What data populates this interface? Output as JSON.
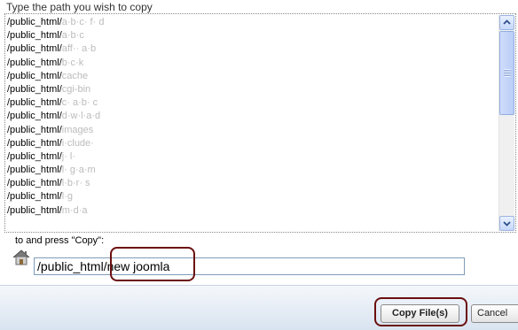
{
  "dialog": {
    "prompt_label": "Type the path you wish to copy",
    "instruction_label": "to and press \"Copy\":",
    "destination_path": "/public_html/new joomla",
    "copy_button_label": "Copy File(s)",
    "cancel_button_label": "Cancel"
  },
  "directory_list": [
    {
      "prefix": "/public_html/",
      "rest": "a·b·c· f· d"
    },
    {
      "prefix": "/public_html/",
      "rest": "a·b·c"
    },
    {
      "prefix": "/public_html/",
      "rest": "aff·· a·b"
    },
    {
      "prefix": "/public_html/",
      "rest": "b·c·k"
    },
    {
      "prefix": "/public_html/",
      "rest": "cache"
    },
    {
      "prefix": "/public_html/",
      "rest": "cgi-bin"
    },
    {
      "prefix": "/public_html/",
      "rest": "c· a·b· c"
    },
    {
      "prefix": "/public_html/",
      "rest": "d·w·l·a·d"
    },
    {
      "prefix": "/public_html/",
      "rest": "images"
    },
    {
      "prefix": "/public_html/",
      "rest": "i·clude·"
    },
    {
      "prefix": "/public_html/",
      "rest": "j· l·"
    },
    {
      "prefix": "/public_html/",
      "rest": "l· g·a·m"
    },
    {
      "prefix": "/public_html/",
      "rest": "l·b·r· s"
    },
    {
      "prefix": "/public_html/",
      "rest": "l·g"
    },
    {
      "prefix": "/public_html/",
      "rest": "m·d·a"
    }
  ],
  "colors": {
    "highlight_annotation": "#6b0f0f",
    "scrollbar_accent": "#b9cdf6"
  },
  "icons": {
    "home": "home-icon",
    "scroll_up": "chevron-up-icon",
    "scroll_down": "chevron-down-icon"
  }
}
